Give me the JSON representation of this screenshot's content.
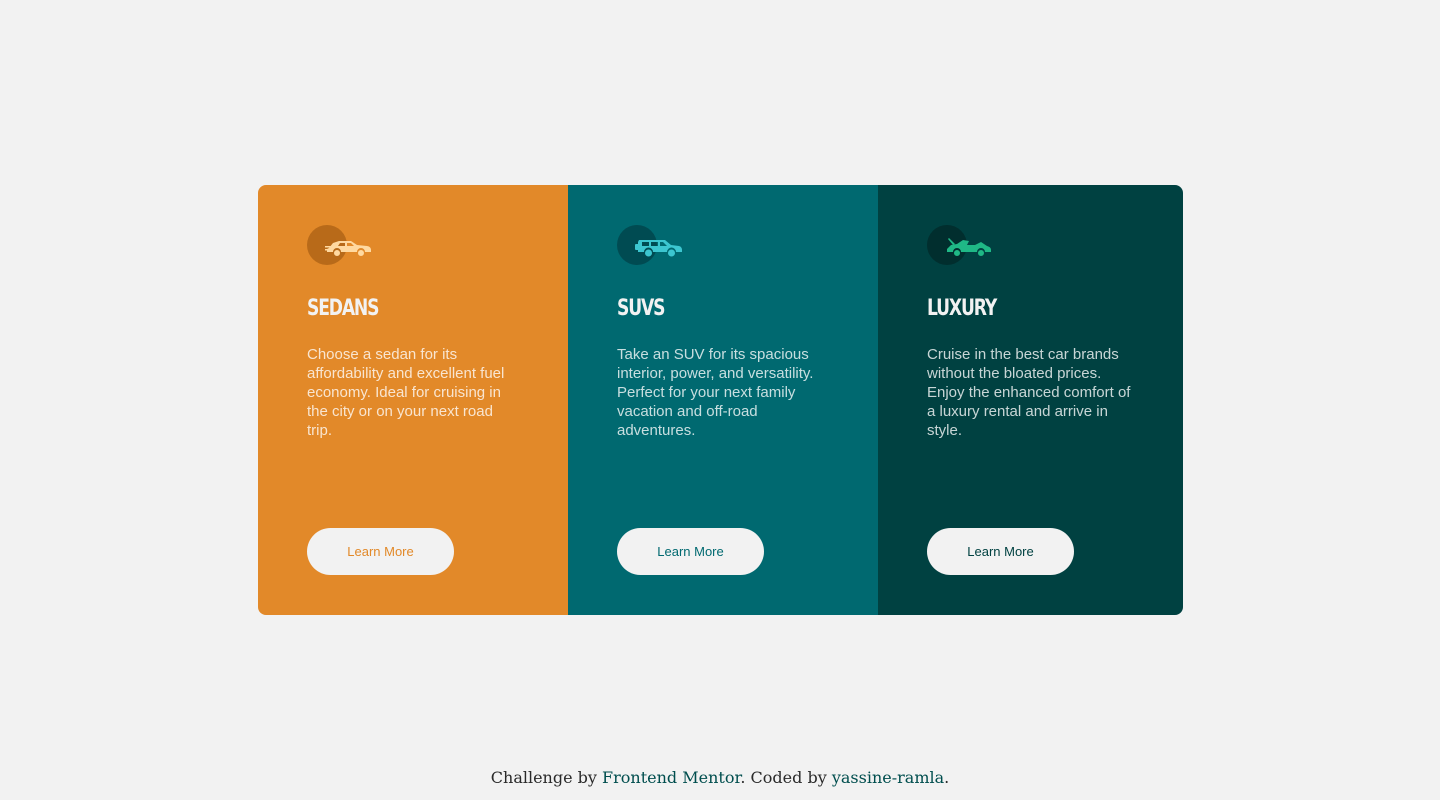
{
  "cards": [
    {
      "icon": "sedan-car-icon",
      "icon_color": "#ffd9a0",
      "title": "Sedans",
      "text": "Choose a sedan for its affordability and excellent fuel economy. Ideal for cruising in the city or on your next road trip.",
      "button": "Learn More",
      "bg": "#e28929"
    },
    {
      "icon": "suv-car-icon",
      "icon_color": "#3cc6d0",
      "title": "SUVs",
      "text": "Take an SUV for its spacious interior, power, and versatility. Perfect for your next family vacation and off-road adventures.",
      "button": "Learn More",
      "bg": "#006970"
    },
    {
      "icon": "luxury-car-icon",
      "icon_color": "#1fb886",
      "title": "Luxury",
      "text": "Cruise in the best car brands without the bloated prices. Enjoy the enhanced comfort of a luxury rental and arrive in style.",
      "button": "Learn More",
      "bg": "#004141"
    }
  ],
  "attribution": {
    "prefix": "Challenge by",
    "link1": "Frontend Mentor",
    "middle": ". Coded by",
    "link2": "yassine-ramla",
    "suffix": "."
  }
}
